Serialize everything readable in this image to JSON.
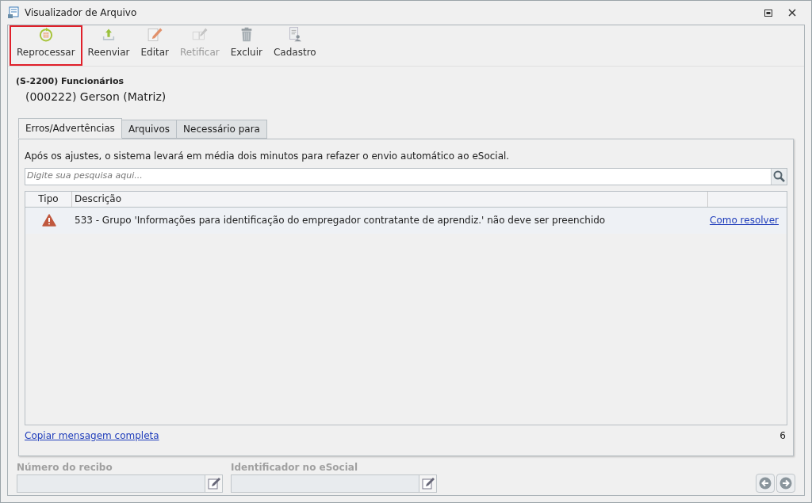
{
  "window": {
    "title": "Visualizador de Arquivo"
  },
  "toolbar": [
    {
      "label": "Reprocessar",
      "kind": "reprocess",
      "selected": true,
      "disabled": false
    },
    {
      "label": "Reenviar",
      "kind": "upload",
      "selected": false,
      "disabled": false
    },
    {
      "label": "Editar",
      "kind": "edit",
      "selected": false,
      "disabled": false
    },
    {
      "label": "Retificar",
      "kind": "rectify",
      "selected": false,
      "disabled": true
    },
    {
      "label": "Excluir",
      "kind": "delete",
      "selected": false,
      "disabled": false
    },
    {
      "label": "Cadastro",
      "kind": "register",
      "selected": false,
      "disabled": false
    }
  ],
  "header": {
    "event": "(S-2200) Funcionários",
    "employee": "(000222) Gerson (Matriz)"
  },
  "tabs": [
    {
      "label": "Erros/Advertências",
      "selected": true
    },
    {
      "label": "Arquivos",
      "selected": false
    },
    {
      "label": "Necessário para",
      "selected": false
    }
  ],
  "notice": "Após os ajustes, o sistema levará em média dois minutos para refazer o envio automático ao eSocial.",
  "search": {
    "placeholder": "Digite sua pesquisa aqui..."
  },
  "table": {
    "columns": [
      "Tipo",
      "Descrição"
    ],
    "rows": [
      {
        "kind": "warning",
        "description": "533 - Grupo 'Informações para identificação do empregador contratante de aprendiz.' não deve ser preenchido",
        "link": "Como resolver"
      }
    ]
  },
  "copy_link": "Copiar mensagem completa",
  "count": "6",
  "fields": [
    {
      "label": "Número do recibo",
      "disabled": true
    },
    {
      "label": "Identificador no eSocial",
      "disabled": true
    }
  ]
}
